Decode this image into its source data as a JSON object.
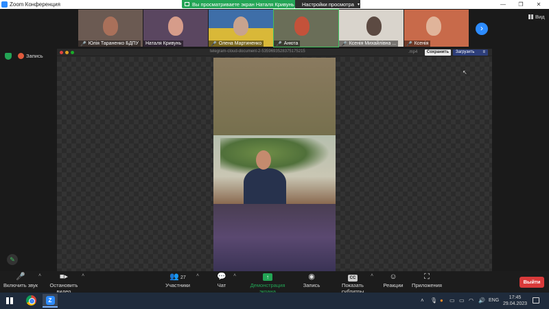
{
  "window": {
    "title": "Zoom Конференция",
    "controls": [
      "—",
      "❐",
      "✕"
    ]
  },
  "banner": {
    "text": "Вы просматриваете экран Наталя Кривунь",
    "view_options": "Настройки просмотра"
  },
  "participants": [
    {
      "name": "Юлія Тараненко БДПУ",
      "muted": true
    },
    {
      "name": "Наталя Кривунь",
      "muted": false
    },
    {
      "name": "Олена Мартиненко",
      "muted": true
    },
    {
      "name": "Анюта",
      "muted": true
    },
    {
      "name": "Ксенія Михайлівна ...",
      "muted": true
    },
    {
      "name": "Ксенія",
      "muted": true
    }
  ],
  "view_label": "Вид",
  "recording_label": "Запись",
  "shared": {
    "filename": "telegram-cloud-document-2-5359693528375175215",
    "extension": ".mp4",
    "save_label": "Сохранить",
    "download_label": "Загрузить"
  },
  "toolbar": {
    "unmute": "Включить звук",
    "stop_video": "Остановить видео",
    "participants": "Участники",
    "participants_count": "27",
    "chat": "Чат",
    "share_screen": "Демонстрация экрана",
    "record": "Запись",
    "subtitles": "Показать субтитры",
    "reactions": "Реакции",
    "apps": "Приложения",
    "leave": "Выйти",
    "cc_badge": "CC"
  },
  "taskbar": {
    "zoom_letter": "Z",
    "language": "ENG",
    "time": "17:45",
    "date": "29.04.2023"
  },
  "colors": {
    "zoom_blue": "#2d8cff",
    "share_green": "#23a455",
    "leave_red": "#d93a3a"
  }
}
